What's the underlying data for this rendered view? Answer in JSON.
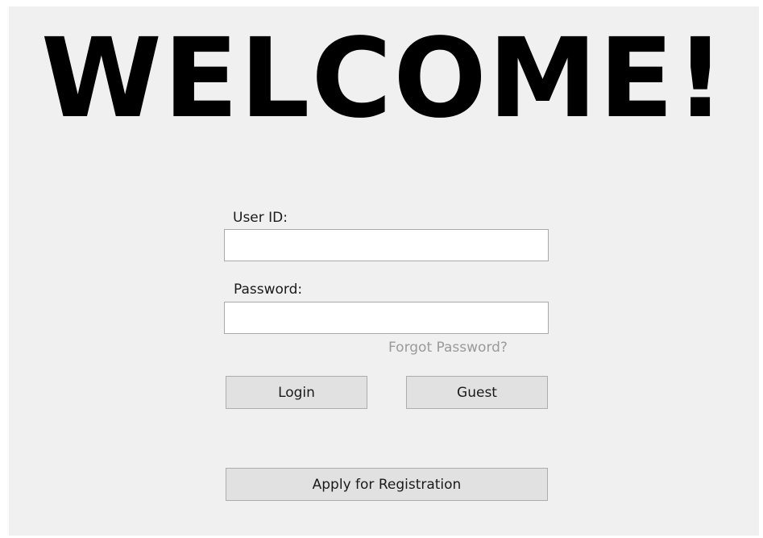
{
  "title": "WELCOME!",
  "form": {
    "user_id_label": "User ID:",
    "user_id_value": "",
    "password_label": "Password:",
    "password_value": "",
    "forgot_password": "Forgot Password?"
  },
  "buttons": {
    "login": "Login",
    "guest": "Guest",
    "register": "Apply for Registration"
  },
  "colors": {
    "background": "#f0f0f0",
    "button_face": "#e1e1e1",
    "button_border": "#adadad",
    "link_gray": "#9a9a9a"
  }
}
